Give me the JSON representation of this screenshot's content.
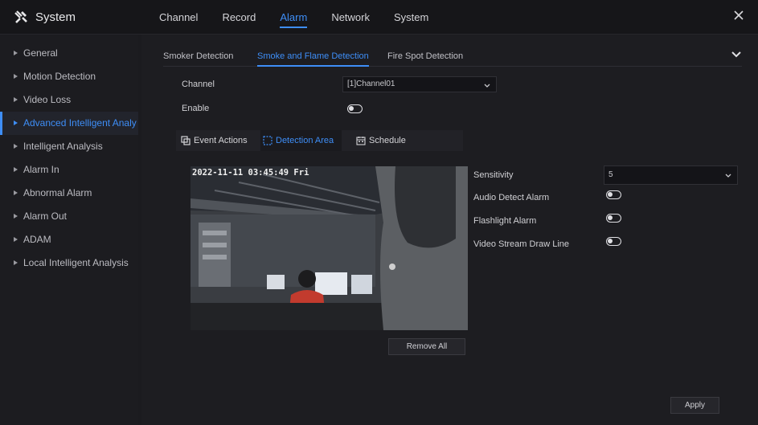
{
  "app": {
    "title": "System",
    "logo_icon": "tools-icon"
  },
  "topnav": {
    "items": [
      "Channel",
      "Record",
      "Alarm",
      "Network",
      "System"
    ],
    "active": "Alarm"
  },
  "sidebar": {
    "items": [
      "General",
      "Motion Detection",
      "Video Loss",
      "Advanced Intelligent Analy",
      "Intelligent Analysis",
      "Alarm In",
      "Abnormal Alarm",
      "Alarm Out",
      "ADAM",
      "Local Intelligent Analysis"
    ],
    "active": "Advanced Intelligent Analy"
  },
  "subtabs": {
    "items": [
      "Smoker Detection",
      "Smoke and Flame Detection",
      "Fire Spot Detection"
    ],
    "active": "Smoke and Flame Detection"
  },
  "form": {
    "channel_label": "Channel",
    "channel_value": "[1]Channel01",
    "enable_label": "Enable",
    "enable_on": false
  },
  "innertabs": {
    "items": [
      "Event Actions",
      "Detection Area",
      "Schedule"
    ],
    "active": "Detection Area"
  },
  "video": {
    "osd_timestamp": "2022-11-11 03:45:49 Fri"
  },
  "settings": {
    "sensitivity_label": "Sensitivity",
    "sensitivity_value": "5",
    "audio_label": "Audio Detect Alarm",
    "audio_on": false,
    "flash_label": "Flashlight Alarm",
    "flash_on": false,
    "drawline_label": "Video Stream Draw Line",
    "drawline_on": false
  },
  "buttons": {
    "remove_all": "Remove All",
    "apply": "Apply"
  },
  "colors": {
    "accent": "#3e8ef7",
    "background": "#1b1b1f"
  }
}
